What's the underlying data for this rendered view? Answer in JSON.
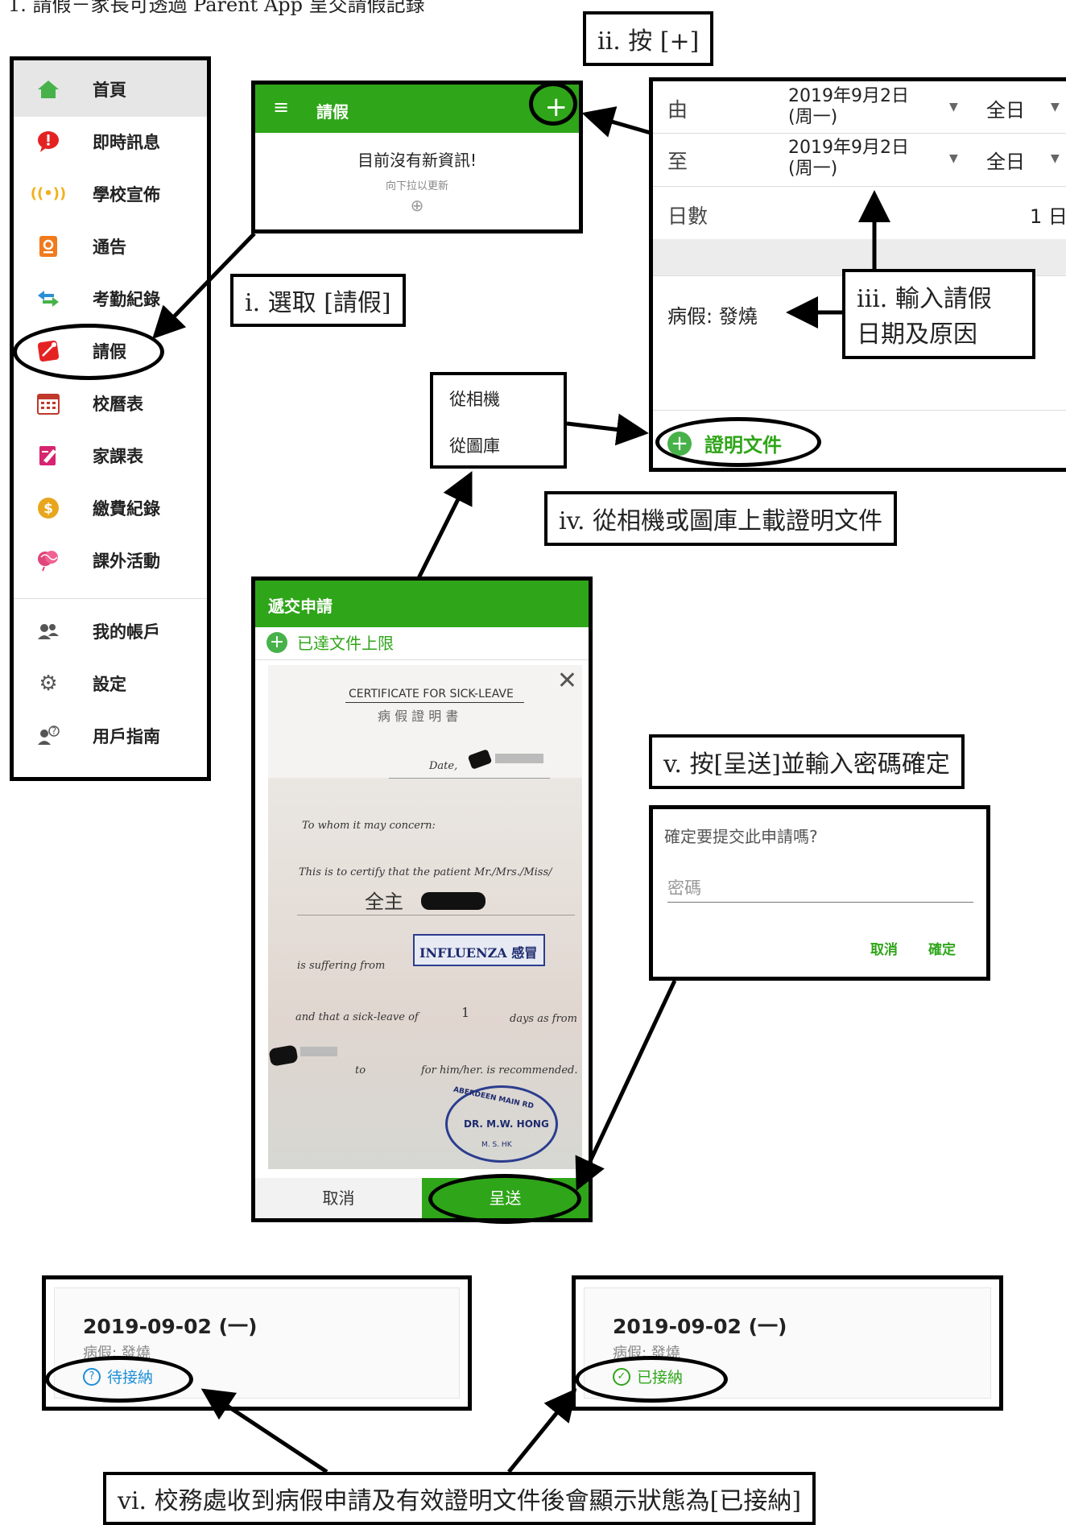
{
  "header_line": "1. 請假－家長可透過 Parent App 呈交請假記錄",
  "sidebar": {
    "items": [
      {
        "label": "首頁",
        "icon": "home-icon"
      },
      {
        "label": "即時訊息",
        "icon": "message-alert-icon"
      },
      {
        "label": "學校宣佈",
        "icon": "broadcast-icon"
      },
      {
        "label": "通告",
        "icon": "notice-icon"
      },
      {
        "label": "考勤紀錄",
        "icon": "attendance-icon"
      },
      {
        "label": "請假",
        "icon": "leave-icon"
      },
      {
        "label": "校曆表",
        "icon": "calendar-icon"
      },
      {
        "label": "家課表",
        "icon": "homework-icon"
      },
      {
        "label": "繳費紀錄",
        "icon": "payment-icon"
      },
      {
        "label": "課外活動",
        "icon": "activity-icon"
      },
      {
        "label": "我的帳戶",
        "icon": "account-icon"
      },
      {
        "label": "設定",
        "icon": "gear-icon"
      },
      {
        "label": "用戶指南",
        "icon": "guide-icon"
      }
    ]
  },
  "app_panel": {
    "title": "請假",
    "add_symbol": "+",
    "empty_title": "目前沒有新資訊!",
    "empty_hint": "向下拉以更新",
    "refresh_symbol": "⊕"
  },
  "form": {
    "from_label": "由",
    "from_date_line1": "2019年9月2日",
    "from_date_line2": "(周一)",
    "from_type": "全日",
    "to_label": "至",
    "to_date_line1": "2019年9月2日",
    "to_date_line2": "(周一)",
    "to_type": "全日",
    "days_label": "日數",
    "days_value": "1 日",
    "reason": "病假: 發燒",
    "proof_button": "證明文件"
  },
  "photo_menu": {
    "camera": "從相機",
    "gallery": "從圖庫"
  },
  "submit_panel": {
    "title": "遞交申請",
    "limit_notice": "已達文件上限",
    "cancel_label": "取消",
    "submit_label": "呈送"
  },
  "certificate": {
    "title": "CERTIFICATE FOR SICK-LEAVE",
    "subtitle": "病 假 證 明 書",
    "date_label": "Date,",
    "to_whom": "To whom it may concern:",
    "certify": "This is to certify that the patient Mr./Mrs./Miss/",
    "suffering": "is suffering from",
    "diagnosis": "INFLUENZA 感冒",
    "sick_leave": "and that a sick-leave of",
    "days": "1",
    "days_as_from": "days as from",
    "to": "to",
    "recommended": "for him/her. is recommended.",
    "stamp_top": "ABERDEEN MAIN RD",
    "stamp_name": "DR. M.W. HONG",
    "stamp_bottom": "M. S. HK"
  },
  "confirm_dialog": {
    "question": "確定要提交此申請嗎?",
    "password_placeholder": "密碼",
    "cancel_label": "取消",
    "confirm_label": "確定"
  },
  "status_cards": [
    {
      "date": "2019-09-02 (一)",
      "reason": "病假: 發燒",
      "status": "待接納",
      "status_color": "#1e8fd6"
    },
    {
      "date": "2019-09-02 (一)",
      "reason": "病假: 發燒",
      "status": "已接納",
      "status_color": "#2fa519"
    }
  ],
  "callouts": {
    "step1": "i. 選取 [請假]",
    "step2": "ii. 按 [+]",
    "step3_line1": "iii. 輸入請假",
    "step3_line2": "日期及原因",
    "step4": "iv. 從相機或圖庫上載證明文件",
    "step5": "v. 按[呈送]並輸入密碼確定",
    "step6": "vi. 校務處收到病假申請及有效證明文件後會顯示狀態為[已接納]"
  },
  "colors": {
    "accent": "#2fa519",
    "pending": "#1e8fd6"
  }
}
